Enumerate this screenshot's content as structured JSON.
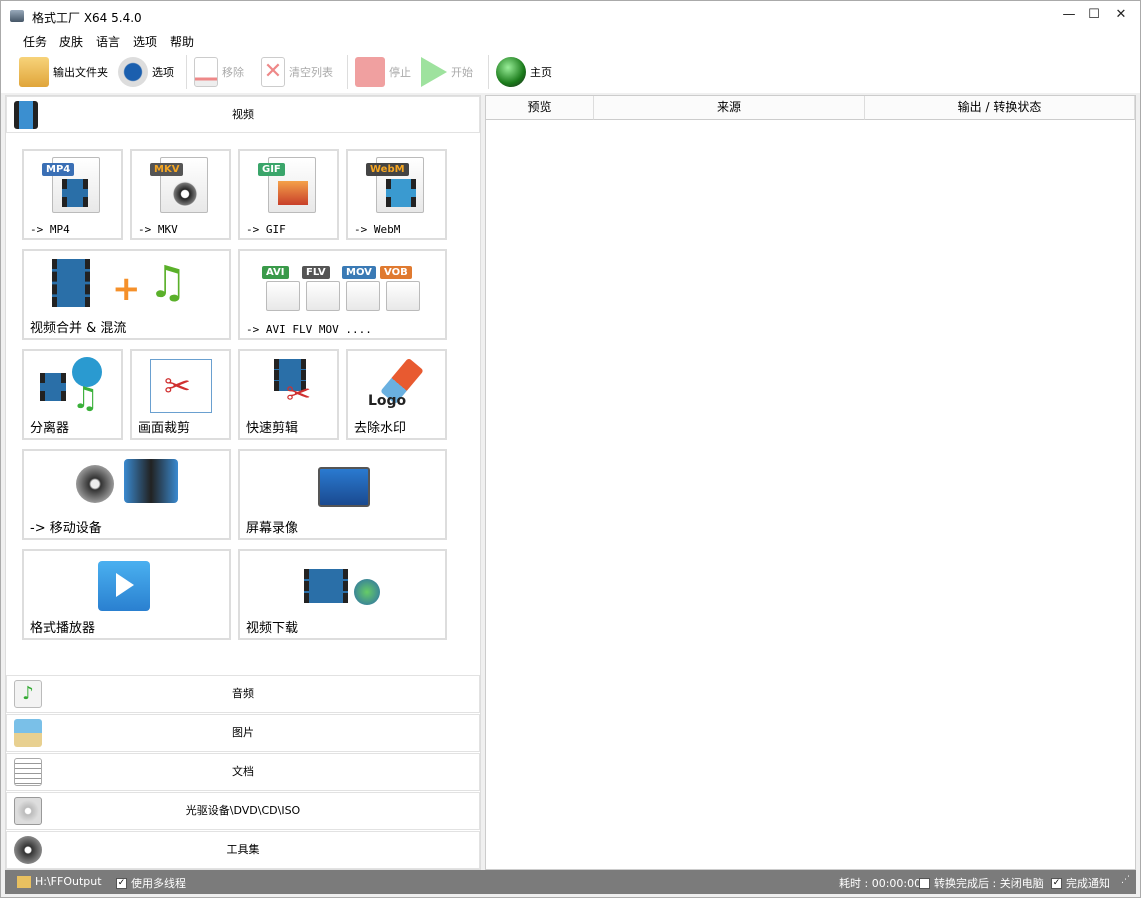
{
  "window": {
    "title": "格式工厂 X64 5.4.0"
  },
  "menu": [
    "任务",
    "皮肤",
    "语言",
    "选项",
    "帮助"
  ],
  "toolbar": {
    "output_folder": "输出文件夹",
    "options": "选项",
    "remove": "移除",
    "clear_list": "清空列表",
    "stop": "停止",
    "start": "开始",
    "home": "主页"
  },
  "left": {
    "video_header": "视频",
    "tiles": [
      {
        "label": "-> MP4",
        "badge": "MP4",
        "color": "#3a6fb5"
      },
      {
        "label": "-> MKV",
        "badge": "MKV",
        "color": "#555555"
      },
      {
        "label": "-> GIF",
        "badge": "GIF",
        "color": "#3aa56a"
      },
      {
        "label": "-> WebM",
        "badge": "WebM",
        "color": "#444444"
      },
      {
        "label": "视频合并 & 混流"
      },
      {
        "label": "-> AVI FLV MOV ....",
        "badges": [
          "AVI",
          "FLV",
          "MOV",
          "VOB"
        ]
      },
      {
        "label": "分离器"
      },
      {
        "label": "画面裁剪"
      },
      {
        "label": "快速剪辑"
      },
      {
        "label": "去除水印",
        "logo_text": "Logo"
      },
      {
        "label": "-> 移动设备"
      },
      {
        "label": "屏幕录像"
      },
      {
        "label": "格式播放器"
      },
      {
        "label": "视频下载"
      }
    ],
    "categories": [
      "音频",
      "图片",
      "文档",
      "光驱设备\\DVD\\CD\\ISO",
      "工具集"
    ]
  },
  "right": {
    "columns": [
      "预览",
      "来源",
      "输出 / 转换状态"
    ]
  },
  "status": {
    "output_path": "H:\\FFOutput",
    "multithread": "使用多线程",
    "multithread_checked": true,
    "elapsed": "耗时 : 00:00:00",
    "shutdown": "转换完成后 : 关闭电脑",
    "shutdown_checked": false,
    "notify": "完成通知",
    "notify_checked": true
  }
}
